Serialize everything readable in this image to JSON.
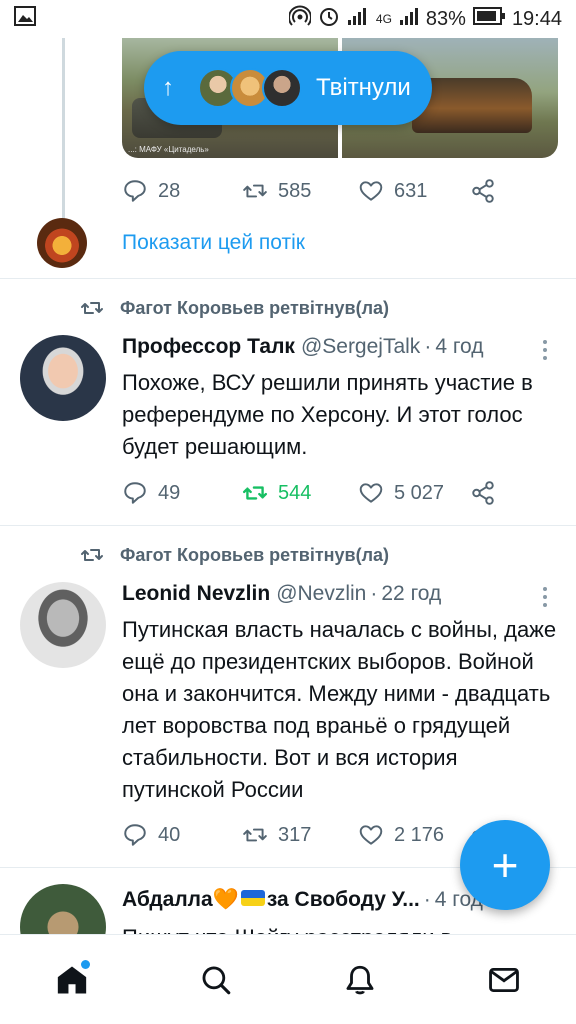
{
  "status_bar": {
    "battery": "83%",
    "network": "4G",
    "time": "19:44"
  },
  "first_tweet": {
    "media_caption": "...: МАФУ «Цитадель»",
    "retweeted_pill_label": "Твітнули",
    "replies": "28",
    "retweets": "585",
    "likes": "631",
    "show_thread": "Показати цей потік"
  },
  "tweets": [
    {
      "retweeted_by": "Фагот Коровьев ретвітнув(ла)",
      "name": "Профессор Талк",
      "handle": "@SergejTalk",
      "dot": "·",
      "time": "4 год",
      "text": "Похоже, ВСУ решили принять участие в референдуме по Херсону. И этот голос будет решающим.",
      "replies": "49",
      "retweets": "544",
      "likes": "5 027"
    },
    {
      "retweeted_by": "Фагот Коровьев ретвітнув(ла)",
      "name": "Leonid Nevzlin",
      "handle": "@Nevzlin",
      "dot": "·",
      "time": "22 год",
      "text": "Путинская власть началась с войны, даже ещё до президентских выборов. Войной она и закончится. Между ними - двадцать лет воровства под враньё о грядущей стабильности. Вот и вся история путинской России",
      "replies": "40",
      "retweets": "317",
      "likes": "2 176"
    },
    {
      "name_prefix": "Абдалла",
      "heart": "🧡",
      "name_suffix": "за Свободу У...",
      "dot": "·",
      "time": "4 год",
      "text": "Пишут что Шойгу расстреляли в"
    }
  ],
  "fab": {
    "label": "+"
  },
  "icons": [
    "image-icon",
    "wifi-hotspot-icon",
    "alarm-icon",
    "signal-icon",
    "battery-icon",
    "reply-icon",
    "retweet-icon",
    "like-icon",
    "share-icon",
    "home-icon",
    "search-icon",
    "notifications-icon",
    "messages-icon"
  ],
  "colors": {
    "accent": "#1d9bf0",
    "retweet_active": "#17bf63",
    "muted": "#536471"
  }
}
